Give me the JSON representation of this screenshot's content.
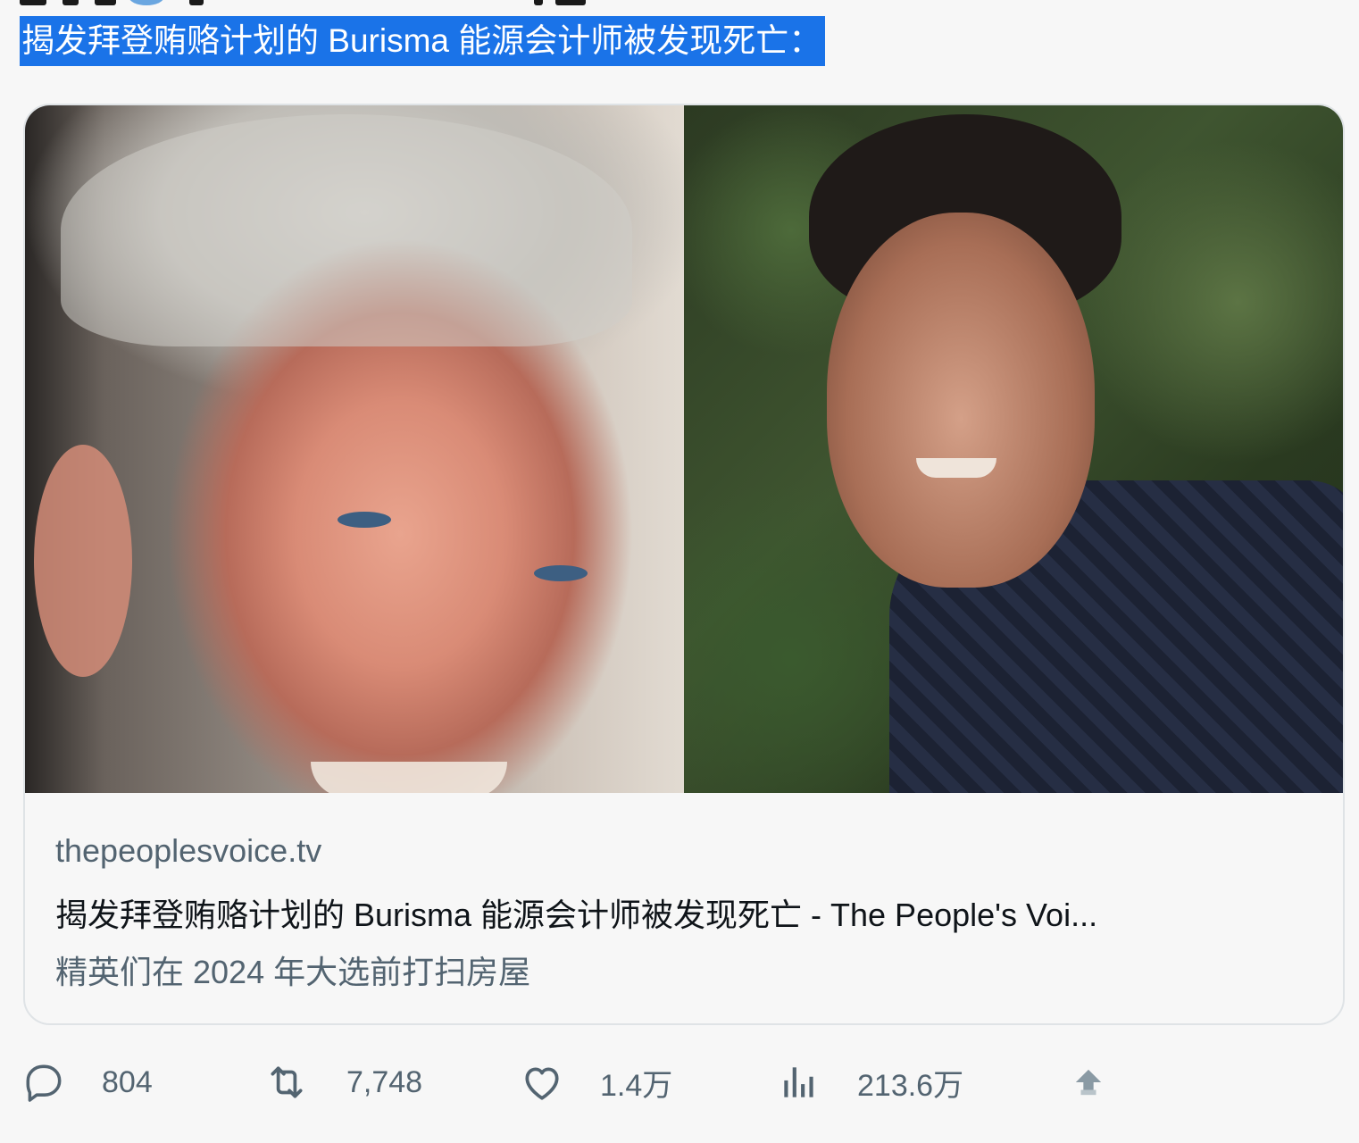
{
  "tweet": {
    "text": "揭发拜登贿赂计划的 Burisma 能源会计师被发现死亡："
  },
  "card": {
    "domain": "thepeoplesvoice.tv",
    "title": "揭发拜登贿赂计划的 Burisma 能源会计师被发现死亡 - The People's Voi...",
    "description": "精英们在 2024 年大选前打扫房屋"
  },
  "actions": {
    "reply_icon": "reply-icon",
    "reply_count": "804",
    "retweet_icon": "retweet-icon",
    "retweet_count": "7,748",
    "like_icon": "heart-icon",
    "like_count": "1.4万",
    "views_icon": "bar-chart-icon",
    "views_count": "213.6万",
    "share_icon": "share-icon"
  },
  "colors": {
    "selection": "#1a73e8",
    "muted_text": "#536471",
    "primary_text": "#0f1419",
    "card_border": "#dfe3e6"
  }
}
